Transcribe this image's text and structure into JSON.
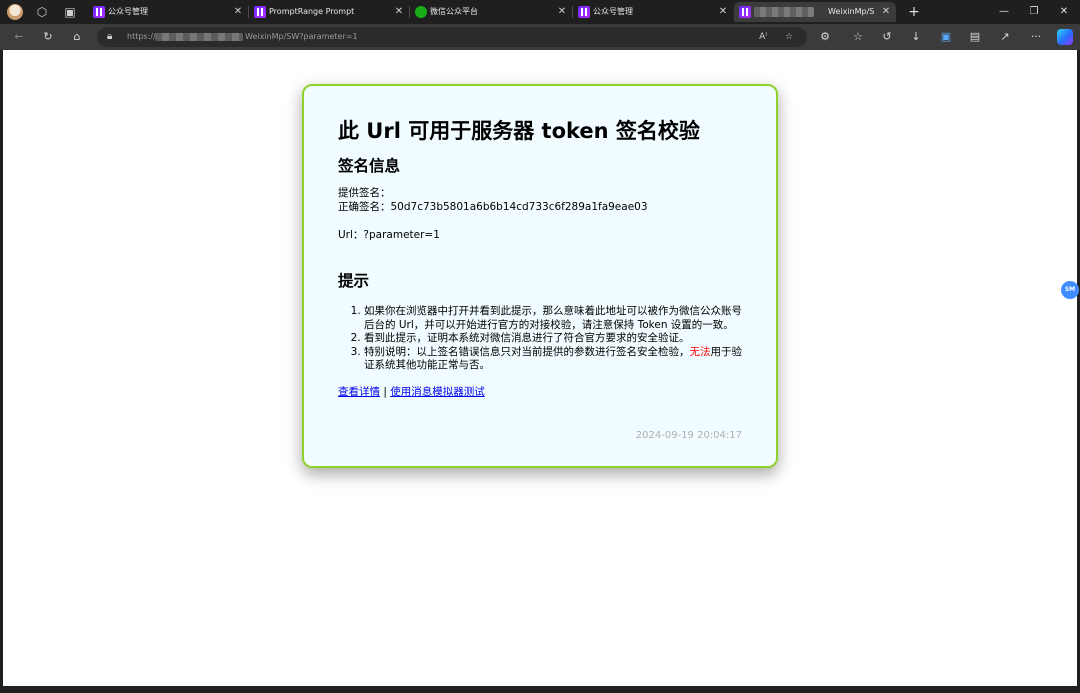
{
  "browser": {
    "tabs": [
      {
        "title": "公众号管理",
        "favicon": "promptrange-icon"
      },
      {
        "title": "PromptRange Prompt",
        "favicon": "promptrange-icon"
      },
      {
        "title": "微信公众平台",
        "favicon": "wechat-icon"
      },
      {
        "title": "公众号管理",
        "favicon": "promptrange-icon"
      },
      {
        "title": "WeixinMp/S\\",
        "favicon": "promptrange-icon",
        "active": true
      }
    ],
    "address": {
      "prefix": "https://",
      "path": "WeixinMp/SW?parameter=1"
    }
  },
  "card": {
    "title": "此 Url 可用于服务器 token 签名校验",
    "sign_section_title": "签名信息",
    "provided_sign_label": "提供签名：",
    "correct_sign_label": "正确签名：",
    "correct_sign_value": "50d7c73b5801a6b6b14cd733c6f289a1fa9eae03",
    "url_label": "Url：",
    "url_value": "?parameter=1",
    "tips_title": "提示",
    "tips": [
      {
        "text": "如果你在浏览器中打开并看到此提示，那么意味着此地址可以被作为微信公众账号后台的 Url，并可以开始进行官方的对接校验，请注意保持 Token 设置的一致。"
      },
      {
        "text": "看到此提示，证明本系统对微信消息进行了符合官方要求的安全验证。"
      },
      {
        "before": "特别说明：以上签名错误信息只对当前提供的参数进行签名安全检验，",
        "warn": "无法",
        "after": "用于验证系统其他功能正常与否。"
      }
    ],
    "link_details": "查看详情",
    "link_separator": "|",
    "link_simulator": "使用消息模拟器测试",
    "timestamp": "2024-09-19 20:04:17"
  },
  "side_badge": "SM",
  "colors": {
    "card_border": "#8fd12a",
    "card_bg": "#f0fcff",
    "warn": "#ff0000",
    "link": "#0000ee"
  }
}
